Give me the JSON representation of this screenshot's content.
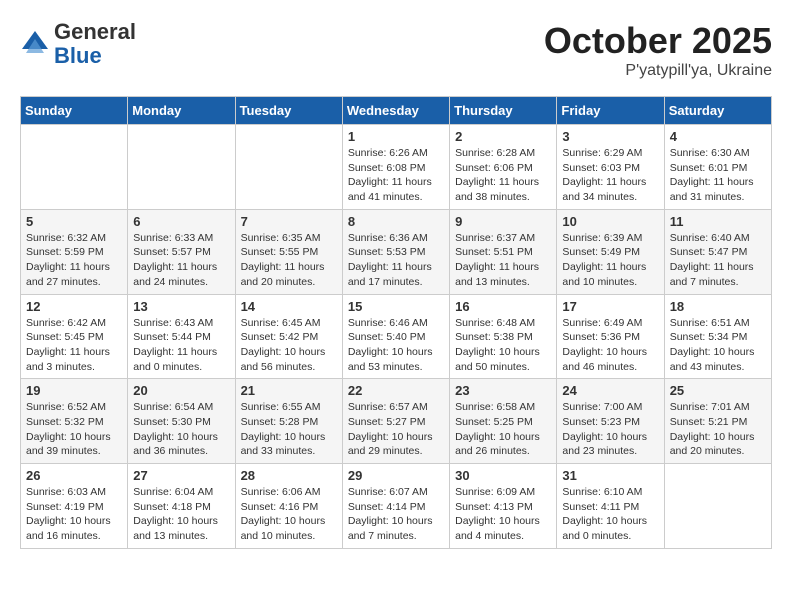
{
  "header": {
    "logo_general": "General",
    "logo_blue": "Blue",
    "month_title": "October 2025",
    "location": "P'yatypill'ya, Ukraine"
  },
  "weekdays": [
    "Sunday",
    "Monday",
    "Tuesday",
    "Wednesday",
    "Thursday",
    "Friday",
    "Saturday"
  ],
  "weeks": [
    [
      {
        "day": "",
        "info": ""
      },
      {
        "day": "",
        "info": ""
      },
      {
        "day": "",
        "info": ""
      },
      {
        "day": "1",
        "info": "Sunrise: 6:26 AM\nSunset: 6:08 PM\nDaylight: 11 hours\nand 41 minutes."
      },
      {
        "day": "2",
        "info": "Sunrise: 6:28 AM\nSunset: 6:06 PM\nDaylight: 11 hours\nand 38 minutes."
      },
      {
        "day": "3",
        "info": "Sunrise: 6:29 AM\nSunset: 6:03 PM\nDaylight: 11 hours\nand 34 minutes."
      },
      {
        "day": "4",
        "info": "Sunrise: 6:30 AM\nSunset: 6:01 PM\nDaylight: 11 hours\nand 31 minutes."
      }
    ],
    [
      {
        "day": "5",
        "info": "Sunrise: 6:32 AM\nSunset: 5:59 PM\nDaylight: 11 hours\nand 27 minutes."
      },
      {
        "day": "6",
        "info": "Sunrise: 6:33 AM\nSunset: 5:57 PM\nDaylight: 11 hours\nand 24 minutes."
      },
      {
        "day": "7",
        "info": "Sunrise: 6:35 AM\nSunset: 5:55 PM\nDaylight: 11 hours\nand 20 minutes."
      },
      {
        "day": "8",
        "info": "Sunrise: 6:36 AM\nSunset: 5:53 PM\nDaylight: 11 hours\nand 17 minutes."
      },
      {
        "day": "9",
        "info": "Sunrise: 6:37 AM\nSunset: 5:51 PM\nDaylight: 11 hours\nand 13 minutes."
      },
      {
        "day": "10",
        "info": "Sunrise: 6:39 AM\nSunset: 5:49 PM\nDaylight: 11 hours\nand 10 minutes."
      },
      {
        "day": "11",
        "info": "Sunrise: 6:40 AM\nSunset: 5:47 PM\nDaylight: 11 hours\nand 7 minutes."
      }
    ],
    [
      {
        "day": "12",
        "info": "Sunrise: 6:42 AM\nSunset: 5:45 PM\nDaylight: 11 hours\nand 3 minutes."
      },
      {
        "day": "13",
        "info": "Sunrise: 6:43 AM\nSunset: 5:44 PM\nDaylight: 11 hours\nand 0 minutes."
      },
      {
        "day": "14",
        "info": "Sunrise: 6:45 AM\nSunset: 5:42 PM\nDaylight: 10 hours\nand 56 minutes."
      },
      {
        "day": "15",
        "info": "Sunrise: 6:46 AM\nSunset: 5:40 PM\nDaylight: 10 hours\nand 53 minutes."
      },
      {
        "day": "16",
        "info": "Sunrise: 6:48 AM\nSunset: 5:38 PM\nDaylight: 10 hours\nand 50 minutes."
      },
      {
        "day": "17",
        "info": "Sunrise: 6:49 AM\nSunset: 5:36 PM\nDaylight: 10 hours\nand 46 minutes."
      },
      {
        "day": "18",
        "info": "Sunrise: 6:51 AM\nSunset: 5:34 PM\nDaylight: 10 hours\nand 43 minutes."
      }
    ],
    [
      {
        "day": "19",
        "info": "Sunrise: 6:52 AM\nSunset: 5:32 PM\nDaylight: 10 hours\nand 39 minutes."
      },
      {
        "day": "20",
        "info": "Sunrise: 6:54 AM\nSunset: 5:30 PM\nDaylight: 10 hours\nand 36 minutes."
      },
      {
        "day": "21",
        "info": "Sunrise: 6:55 AM\nSunset: 5:28 PM\nDaylight: 10 hours\nand 33 minutes."
      },
      {
        "day": "22",
        "info": "Sunrise: 6:57 AM\nSunset: 5:27 PM\nDaylight: 10 hours\nand 29 minutes."
      },
      {
        "day": "23",
        "info": "Sunrise: 6:58 AM\nSunset: 5:25 PM\nDaylight: 10 hours\nand 26 minutes."
      },
      {
        "day": "24",
        "info": "Sunrise: 7:00 AM\nSunset: 5:23 PM\nDaylight: 10 hours\nand 23 minutes."
      },
      {
        "day": "25",
        "info": "Sunrise: 7:01 AM\nSunset: 5:21 PM\nDaylight: 10 hours\nand 20 minutes."
      }
    ],
    [
      {
        "day": "26",
        "info": "Sunrise: 6:03 AM\nSunset: 4:19 PM\nDaylight: 10 hours\nand 16 minutes."
      },
      {
        "day": "27",
        "info": "Sunrise: 6:04 AM\nSunset: 4:18 PM\nDaylight: 10 hours\nand 13 minutes."
      },
      {
        "day": "28",
        "info": "Sunrise: 6:06 AM\nSunset: 4:16 PM\nDaylight: 10 hours\nand 10 minutes."
      },
      {
        "day": "29",
        "info": "Sunrise: 6:07 AM\nSunset: 4:14 PM\nDaylight: 10 hours\nand 7 minutes."
      },
      {
        "day": "30",
        "info": "Sunrise: 6:09 AM\nSunset: 4:13 PM\nDaylight: 10 hours\nand 4 minutes."
      },
      {
        "day": "31",
        "info": "Sunrise: 6:10 AM\nSunset: 4:11 PM\nDaylight: 10 hours\nand 0 minutes."
      },
      {
        "day": "",
        "info": ""
      }
    ]
  ]
}
